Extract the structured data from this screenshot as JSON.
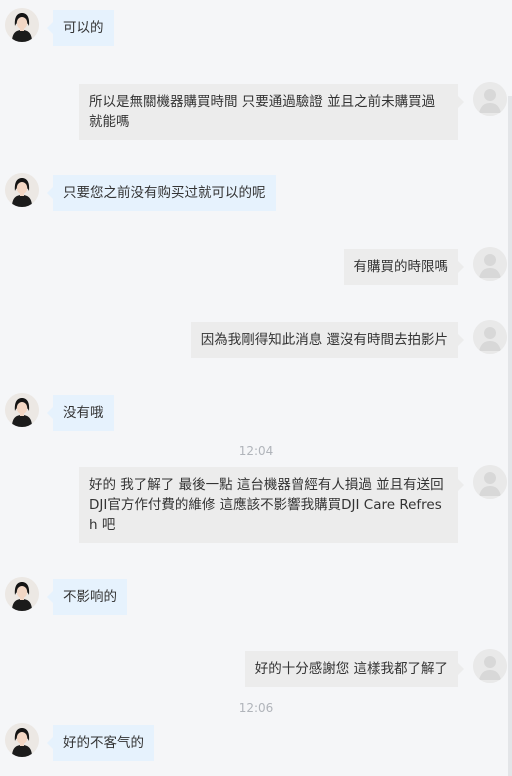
{
  "messages": [
    {
      "sender": "agent",
      "text": "可以的"
    },
    {
      "sender": "user",
      "text": "所以是無關機器購買時間 只要通過驗證 並且之前未購買過就能嗎"
    },
    {
      "sender": "agent",
      "text": "只要您之前没有购买过就可以的呢"
    },
    {
      "sender": "user",
      "text": "有購買的時限嗎"
    },
    {
      "sender": "user",
      "text": "因為我剛得知此消息 還沒有時間去拍影片"
    },
    {
      "sender": "agent",
      "text": "没有哦"
    },
    {
      "timestamp": "12:04"
    },
    {
      "sender": "user",
      "text": "好的 我了解了 最後一點 這台機器曾經有人損過 並且有送回DJI官方作付費的維修 這應該不影響我購買DJI Care Refresh 吧"
    },
    {
      "sender": "agent",
      "text": "不影响的"
    },
    {
      "sender": "user",
      "text": "好的十分感謝您 這樣我都了解了"
    },
    {
      "timestamp": "12:06"
    },
    {
      "sender": "agent",
      "text": "好的不客气的"
    }
  ],
  "icons": {
    "agent_avatar": "agent-avatar-icon",
    "user_avatar": "user-avatar-icon"
  },
  "colors": {
    "background": "#f5f6f8",
    "agent_bubble": "#e6f2fd",
    "user_bubble": "#ececec",
    "timestamp": "#b0b4ba"
  }
}
